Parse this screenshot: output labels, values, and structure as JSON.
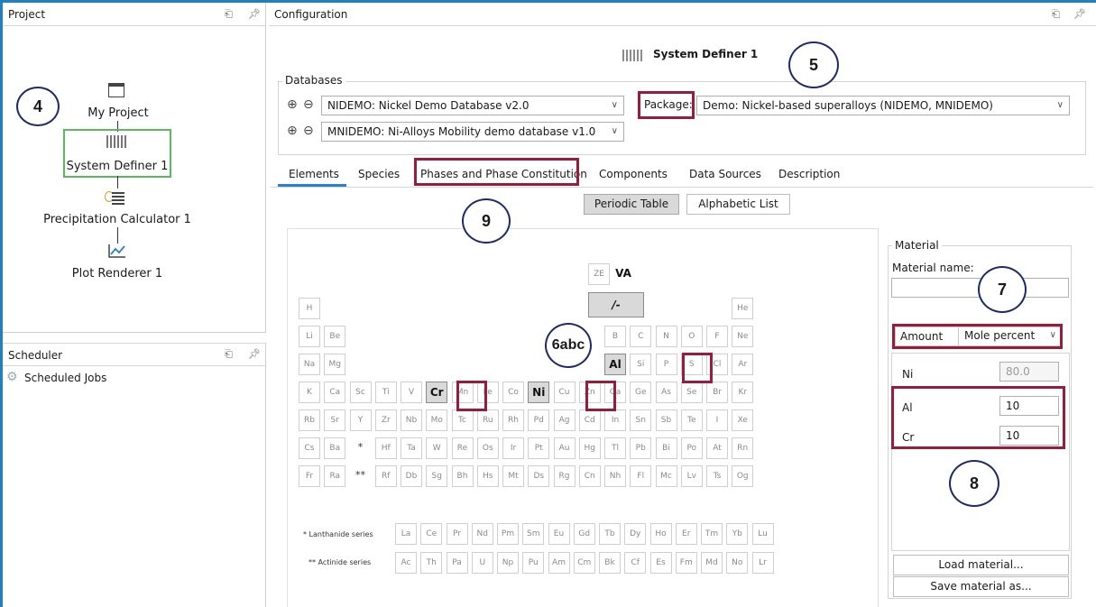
{
  "project": {
    "title": "Project",
    "items": [
      {
        "label": "My Project"
      },
      {
        "label": "System Definer 1"
      },
      {
        "label": "Precipitation Calculator 1"
      },
      {
        "label": "Plot Renderer 1"
      }
    ]
  },
  "scheduler": {
    "title": "Scheduler",
    "jobs_label": "Scheduled Jobs"
  },
  "configuration": {
    "title": "Configuration",
    "header": "System Definer 1",
    "databases_label": "Databases",
    "db1": "NIDEMO: Nickel Demo Database v2.0",
    "db2": "MNIDEMO: Ni-Alloys Mobility demo database v1.0",
    "package_label": "Package:",
    "package_value": "Demo: Nickel-based superalloys (NIDEMO, MNIDEMO)",
    "tabs": [
      "Elements",
      "Species",
      "Phases and Phase Constitution",
      "Components",
      "Data Sources",
      "Description"
    ],
    "view_buttons": [
      "Periodic Table",
      "Alphabetic List"
    ]
  },
  "periodic_table": {
    "special": [
      "ZE",
      "VA",
      "/-"
    ],
    "rows": [
      [
        "H",
        "",
        "",
        "",
        "",
        "",
        "",
        "",
        "",
        "",
        "",
        "",
        "",
        "",
        "",
        "",
        "",
        "He"
      ],
      [
        "Li",
        "Be",
        "",
        "",
        "",
        "",
        "",
        "",
        "",
        "",
        "",
        "",
        "B",
        "C",
        "N",
        "O",
        "F",
        "Ne"
      ],
      [
        "Na",
        "Mg",
        "",
        "",
        "",
        "",
        "",
        "",
        "",
        "",
        "",
        "",
        "Al",
        "Si",
        "P",
        "S",
        "Cl",
        "Ar"
      ],
      [
        "K",
        "Ca",
        "Sc",
        "Ti",
        "V",
        "Cr",
        "Mn",
        "Fe",
        "Co",
        "Ni",
        "Cu",
        "Zn",
        "Ga",
        "Ge",
        "As",
        "Se",
        "Br",
        "Kr"
      ],
      [
        "Rb",
        "Sr",
        "Y",
        "Zr",
        "Nb",
        "Mo",
        "Tc",
        "Ru",
        "Rh",
        "Pd",
        "Ag",
        "Cd",
        "In",
        "Sn",
        "Sb",
        "Te",
        "I",
        "Xe"
      ],
      [
        "Cs",
        "Ba",
        "*",
        "Hf",
        "Ta",
        "W",
        "Re",
        "Os",
        "Ir",
        "Pt",
        "Au",
        "Hg",
        "Tl",
        "Pb",
        "Bi",
        "Po",
        "At",
        "Rn"
      ],
      [
        "Fr",
        "Ra",
        "**",
        "Rf",
        "Db",
        "Sg",
        "Bh",
        "Hs",
        "Mt",
        "Ds",
        "Rg",
        "Cn",
        "Nh",
        "Fl",
        "Mc",
        "Lv",
        "Ts",
        "Og"
      ]
    ],
    "lanthanide_label": "* Lanthanide series",
    "actinide_label": "** Actinide series",
    "lanthanides": [
      "La",
      "Ce",
      "Pr",
      "Nd",
      "Pm",
      "Sm",
      "Eu",
      "Gd",
      "Tb",
      "Dy",
      "Ho",
      "Er",
      "Tm",
      "Yb",
      "Lu"
    ],
    "actinides": [
      "Ac",
      "Th",
      "Pa",
      "U",
      "Np",
      "Pu",
      "Am",
      "Cm",
      "Bk",
      "Cf",
      "Es",
      "Fm",
      "Md",
      "No",
      "Lr"
    ],
    "selected": [
      "VA",
      "/-",
      "Cr",
      "Ni",
      "Al"
    ]
  },
  "material": {
    "group_label": "Material",
    "name_label": "Material name:",
    "name_value": "",
    "amount_label": "Amount",
    "amount_unit": "Mole percent",
    "rows": [
      {
        "element": "Ni",
        "value": "80.0"
      },
      {
        "element": "Al",
        "value": "10"
      },
      {
        "element": "Cr",
        "value": "10"
      }
    ],
    "load_button": "Load material...",
    "save_button": "Save material as..."
  },
  "callouts": [
    "4",
    "5",
    "6abc",
    "7",
    "8",
    "9"
  ]
}
